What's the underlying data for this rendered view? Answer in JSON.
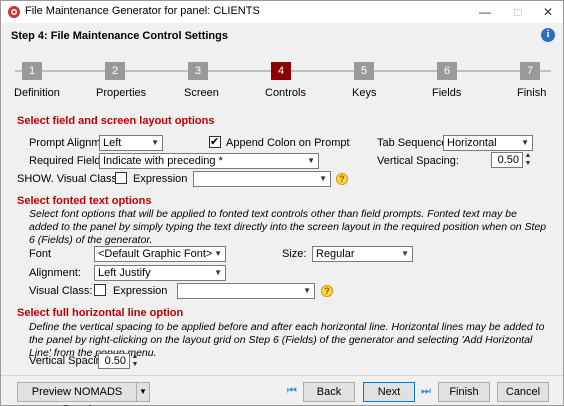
{
  "window": {
    "title": "File Maintenance Generator for panel: CLIENTS",
    "controls": [
      "—",
      "□",
      "✕"
    ]
  },
  "header": {
    "step_title": "Step 4: File Maintenance Control Settings",
    "info_icon": "i"
  },
  "stepper": {
    "steps": [
      {
        "num": "1",
        "label": "Definition"
      },
      {
        "num": "2",
        "label": "Properties"
      },
      {
        "num": "3",
        "label": "Screen"
      },
      {
        "num": "4",
        "label": "Controls"
      },
      {
        "num": "5",
        "label": "Keys"
      },
      {
        "num": "6",
        "label": "Fields"
      },
      {
        "num": "7",
        "label": "Finish"
      }
    ],
    "active_index": 3,
    "active_color": "#8b0000"
  },
  "field_layout": {
    "title": "Select field and screen layout options",
    "prompt_alignment_label": "Prompt Alignment:",
    "prompt_alignment_value": "Left",
    "append_colon_label": "Append Colon on Prompt",
    "append_colon_checked": true,
    "tab_sequence_label": "Tab Sequence:",
    "tab_sequence_value": "Horizontal",
    "required_fields_label": "Required Fields:",
    "required_fields_value": "Indicate with preceding *",
    "vertical_spacing_label": "Vertical Spacing:",
    "vertical_spacing_value": "0.50",
    "visual_class_label": "SHOW. Visual Class:",
    "expression_label": "Expression",
    "expression_checked": false,
    "visual_class_value": ""
  },
  "fonted_text": {
    "title": "Select fonted text options",
    "description": "Select font options that will be applied to fonted text controls other than field prompts.  Fonted text may be added to the panel by simply typing the text directly into the screen layout in the required position when on Step 6 (Fields) of the generator.",
    "font_label": "Font",
    "font_value": "<Default Graphic Font>",
    "size_label": "Size:",
    "size_value": "Regular",
    "alignment_label": "Alignment:",
    "alignment_value": "Left Justify",
    "visual_class_label": "Visual Class:",
    "expression_label": "Expression",
    "expression_checked": false,
    "visual_class_value": ""
  },
  "horizontal_line": {
    "title": "Select full horizontal line option",
    "description": "Define the vertical spacing to be applied before and after each horizontal line. Horizontal lines may be added to the panel by right-clicking on the layout grid on Step 6 (Fields) of the generator and selecting 'Add Horizontal Line' from the popup menu.",
    "vertical_spacing_label": "Vertical Spacing:",
    "vertical_spacing_value": "0.50"
  },
  "footer": {
    "preview_label": "Preview NOMADS Panel",
    "back_label": "Back",
    "next_label": "Next",
    "finish_label": "Finish",
    "cancel_label": "Cancel"
  }
}
